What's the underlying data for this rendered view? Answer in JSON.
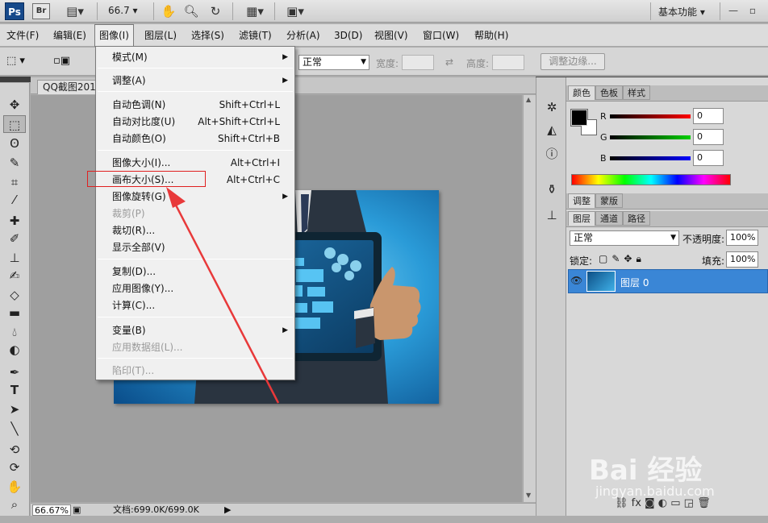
{
  "appbar": {
    "logo_ps": "Ps",
    "logo_br": "Br",
    "zoom": "66.7",
    "workspace": "基本功能"
  },
  "menubar": {
    "items": [
      "文件(F)",
      "编辑(E)",
      "图像(I)",
      "图层(L)",
      "选择(S)",
      "滤镜(T)",
      "分析(A)",
      "3D(D)",
      "视图(V)",
      "窗口(W)",
      "帮助(H)"
    ]
  },
  "options": {
    "mode": "正常",
    "width_label": "宽度:",
    "height_label": "高度:",
    "refine_edge": "调整边缘..."
  },
  "document": {
    "tab_title": "QQ截图2018",
    "zoom_status": "66.67%",
    "doc_size": "文档:699.0K/699.0K"
  },
  "image_menu": {
    "mode": "模式(M)",
    "adjust": "调整(A)",
    "auto_tone": "自动色调(N)",
    "auto_tone_sc": "Shift+Ctrl+L",
    "auto_contrast": "自动对比度(U)",
    "auto_contrast_sc": "Alt+Shift+Ctrl+L",
    "auto_color": "自动颜色(O)",
    "auto_color_sc": "Shift+Ctrl+B",
    "image_size": "图像大小(I)...",
    "image_size_sc": "Alt+Ctrl+I",
    "canvas_size": "画布大小(S)...",
    "canvas_size_sc": "Alt+Ctrl+C",
    "rotation": "图像旋转(G)",
    "crop": "裁剪(P)",
    "trim": "裁切(R)...",
    "reveal_all": "显示全部(V)",
    "duplicate": "复制(D)...",
    "apply_image": "应用图像(Y)...",
    "calculations": "计算(C)...",
    "variables": "变量(B)",
    "apply_data_set": "应用数据组(L)...",
    "trap": "陷印(T)..."
  },
  "color_panel": {
    "tabs": [
      "颜色",
      "色板",
      "样式"
    ],
    "r_label": "R",
    "r_value": "0",
    "g_label": "G",
    "g_value": "0",
    "b_label": "B",
    "b_value": "0"
  },
  "adjust_panel": {
    "tabs": [
      "调整",
      "蒙版"
    ]
  },
  "layers_panel": {
    "tabs": [
      "图层",
      "通道",
      "路径"
    ],
    "blend_mode": "正常",
    "opacity_label": "不透明度:",
    "opacity_value": "100%",
    "lock_label": "锁定:",
    "fill_label": "填充:",
    "fill_value": "100%",
    "layer_name": "图层 0"
  },
  "watermark": {
    "text": "Bai 经验",
    "url": "jingyan.baidu.com"
  },
  "colors": {
    "menu_highlight_box": "#e02020",
    "arrow": "#e8393a",
    "layer_selected": "#3a86d6"
  }
}
